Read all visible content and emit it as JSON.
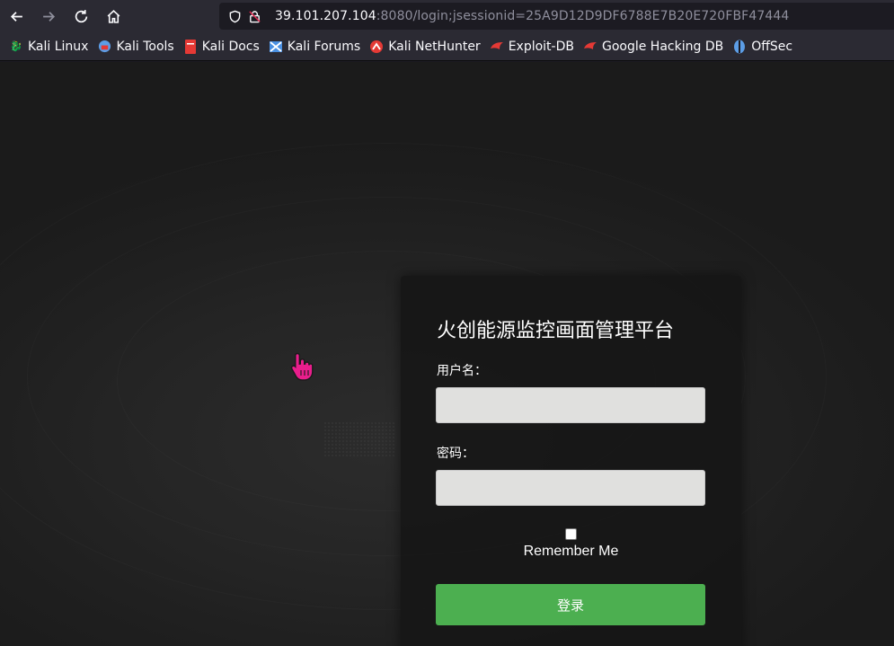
{
  "browser": {
    "url_host": "39.101.207.104",
    "url_rest": ":8080/login;jsessionid=25A9D12D9DF6788E7B20E720FBF47444",
    "nav_icons": [
      "back-arrow-icon",
      "forward-arrow-icon",
      "reload-icon",
      "home-icon"
    ],
    "bookmarks": [
      {
        "label": "Kali Linux",
        "icon": "kali-dragon-icon",
        "color": "#9e9e9e"
      },
      {
        "label": "Kali Tools",
        "icon": "kali-tools-icon",
        "color": "#5c9de6"
      },
      {
        "label": "Kali Docs",
        "icon": "kali-docs-icon",
        "color": "#e53935"
      },
      {
        "label": "Kali Forums",
        "icon": "kali-forums-icon",
        "color": "#4a90e2"
      },
      {
        "label": "Kali NetHunter",
        "icon": "nethunter-icon",
        "color": "#e53935"
      },
      {
        "label": "Exploit-DB",
        "icon": "exploit-db-icon",
        "color": "#e53935"
      },
      {
        "label": "Google Hacking DB",
        "icon": "ghdb-icon",
        "color": "#e53935"
      },
      {
        "label": "OffSec",
        "icon": "offsec-icon",
        "color": "#5c9de6"
      }
    ]
  },
  "login": {
    "title": "火创能源监控画面管理平台",
    "username_label": "用户名：",
    "username_value": "",
    "password_label": "密码：",
    "password_value": "",
    "remember_label": "Remember Me",
    "remember_checked": false,
    "submit_label": "登录"
  },
  "colors": {
    "submit_button": "#4caf50",
    "cursor": "#e91e8c"
  }
}
